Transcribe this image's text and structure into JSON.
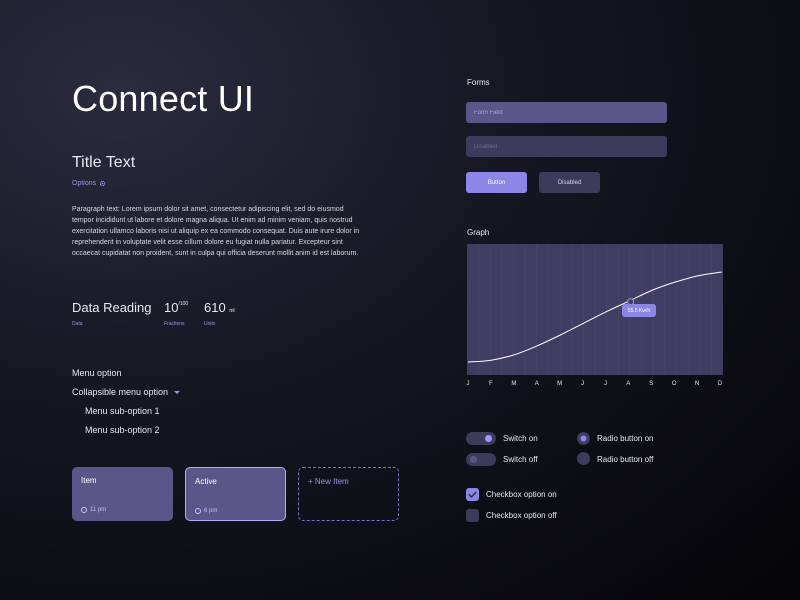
{
  "page": {
    "title": "Connect UI"
  },
  "typography": {
    "title_text": "Title Text",
    "options_label": "Options",
    "paragraph": "Paragraph text: Lorem ipsum dolor sit amet, consectetur adipiscing elit, sed do eiusmod tempor incididunt ut labore et dolore magna aliqua. Ut enim ad minim veniam, quis nostrud exercitation ullamco laboris nisi ut aliquip ex ea commodo consequat. Duis aute irure dolor in reprehenderit in voluptate velit esse cillum dolore eu fugiat nulla pariatur. Excepteur sint occaecat cupidatat non proident, sunt in culpa qui officia deserunt mollit anim id est laborum."
  },
  "data_reading": {
    "label": "Data Reading",
    "data_caption": "Data",
    "fraction_main": "10",
    "fraction_sup": "/100",
    "fraction_caption": "Fractions",
    "units_main": "610",
    "units_suffix": "ml",
    "units_caption": "Units"
  },
  "menu": {
    "option": "Menu option",
    "collapsible": "Collapsible menu option",
    "sub_options": [
      "Menu sub-option 1",
      "Menu sub-option 2"
    ]
  },
  "cards": [
    {
      "title": "Item",
      "time": "11 pm"
    },
    {
      "title": "Active",
      "time": "6 pm"
    },
    {
      "title": "+ New Item"
    }
  ],
  "forms": {
    "heading": "Forms",
    "field_placeholder": "Form Field",
    "disabled_placeholder": "Disabled",
    "button_label": "Button",
    "disabled_button_label": "Disabled"
  },
  "graph": {
    "heading": "Graph",
    "tooltip": "55.5 Kw/h",
    "highlight_index": 7
  },
  "chart_data": {
    "type": "line",
    "categories": [
      "J",
      "F",
      "M",
      "A",
      "M",
      "J",
      "J",
      "A",
      "S",
      "O",
      "N",
      "D"
    ],
    "values": [
      0,
      2,
      8,
      18,
      30,
      43,
      56,
      68,
      80,
      89,
      96,
      100
    ],
    "ylim": [
      0,
      100
    ],
    "grid": true
  },
  "toggles": {
    "switch_on": "Switch on",
    "switch_off": "Switch off",
    "radio_on": "Radio button on",
    "radio_off": "Radio button off",
    "checkbox_on": "Checkbox option on",
    "checkbox_off": "Checkbox option off"
  },
  "colors": {
    "accent": "#8d86e6",
    "card": "#5a5689",
    "muted": "#3c3b5c",
    "graph_bg": "#403d63"
  }
}
